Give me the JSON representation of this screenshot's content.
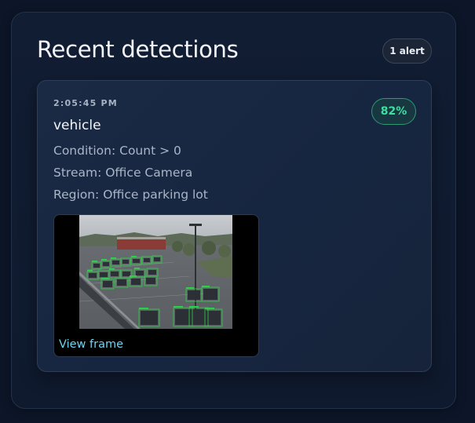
{
  "panel": {
    "title": "Recent detections",
    "alert_badge": "1 alert"
  },
  "detection": {
    "time": "2:05:45 PM",
    "label": "vehicle",
    "confidence": "82%",
    "condition": "Condition: Count > 0",
    "stream": "Stream: Office Camera",
    "region": "Region: Office parking lot",
    "view_frame_label": "View frame",
    "frame_image_icon": "parking-lot-camera-frame"
  },
  "colors": {
    "background": "#0c1628",
    "card": "#1a2a44",
    "confidence_green": "#3be0a0",
    "link_cyan": "#6fd3f2",
    "bbox_green": "#2fd24a"
  }
}
